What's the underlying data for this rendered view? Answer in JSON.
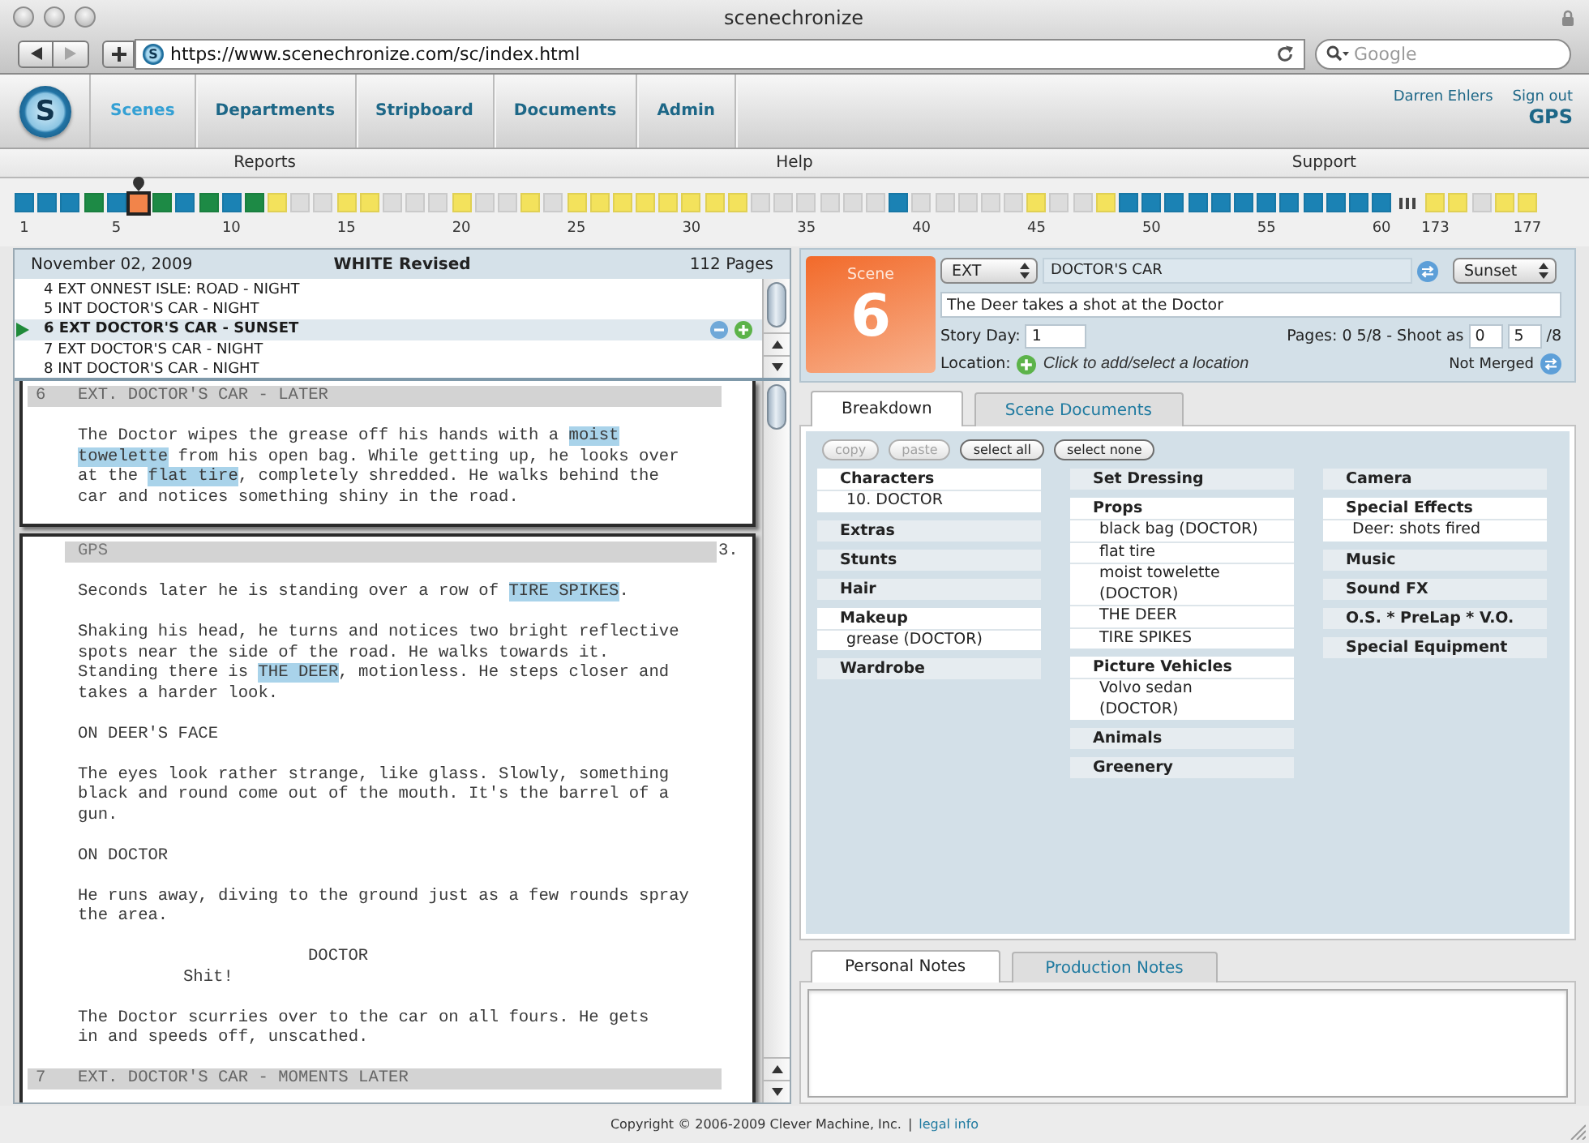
{
  "browser": {
    "title": "scenechronize",
    "nav_buttons": [
      {
        "kind": "back",
        "disabled": false
      },
      {
        "kind": "forward",
        "disabled": true
      }
    ],
    "favicon_letter": "S",
    "url": "https://www.scenechronize.com/sc/index.html",
    "search": {
      "placeholder": "Google"
    }
  },
  "app_header": {
    "logo_letter": "S",
    "nav": [
      {
        "label": "Scenes",
        "selected": true
      },
      {
        "label": "Departments",
        "selected": false
      },
      {
        "label": "Stripboard",
        "selected": false
      },
      {
        "label": "Documents",
        "selected": false
      },
      {
        "label": "Admin",
        "selected": false
      }
    ],
    "user": "Darren Ehlers",
    "sign_out": "Sign out",
    "project": "GPS"
  },
  "subnav": [
    "Reports",
    "Help",
    "Support"
  ],
  "strip": {
    "segments": [
      {
        "squares": [
          {
            "color": "#1b82b4",
            "selected": false,
            "label": "1"
          },
          {
            "color": "#1b82b4",
            "selected": false
          },
          {
            "color": "#1b82b4",
            "selected": false
          },
          {
            "color": "#1d8a45",
            "selected": false
          },
          {
            "color": "#1b82b4",
            "selected": false,
            "label": "5"
          },
          {
            "color": "#f2844a",
            "selected": true
          },
          {
            "color": "#1d8a45",
            "selected": false
          },
          {
            "color": "#1b82b4",
            "selected": false
          },
          {
            "color": "#1d8a45",
            "selected": false
          },
          {
            "color": "#1b82b4",
            "selected": false,
            "label": "10"
          },
          {
            "color": "#1d8a45",
            "selected": false
          },
          {
            "color": "#f3e25c",
            "selected": false
          },
          {
            "color": "#dcdcdc",
            "selected": false
          },
          {
            "color": "#dcdcdc",
            "selected": false
          },
          {
            "color": "#f3e25c",
            "selected": false,
            "label": "15"
          },
          {
            "color": "#f3e25c",
            "selected": false
          },
          {
            "color": "#dcdcdc",
            "selected": false
          },
          {
            "color": "#dcdcdc",
            "selected": false
          },
          {
            "color": "#dcdcdc",
            "selected": false
          },
          {
            "color": "#f3e25c",
            "selected": false,
            "label": "20"
          },
          {
            "color": "#dcdcdc",
            "selected": false
          },
          {
            "color": "#dcdcdc",
            "selected": false
          },
          {
            "color": "#f3e25c",
            "selected": false
          },
          {
            "color": "#dcdcdc",
            "selected": false
          },
          {
            "color": "#f3e25c",
            "selected": false,
            "label": "25"
          },
          {
            "color": "#f3e25c",
            "selected": false
          },
          {
            "color": "#f3e25c",
            "selected": false
          },
          {
            "color": "#f3e25c",
            "selected": false
          },
          {
            "color": "#f3e25c",
            "selected": false
          },
          {
            "color": "#f3e25c",
            "selected": false,
            "label": "30"
          },
          {
            "color": "#f3e25c",
            "selected": false
          },
          {
            "color": "#f3e25c",
            "selected": false
          },
          {
            "color": "#dcdcdc",
            "selected": false
          },
          {
            "color": "#dcdcdc",
            "selected": false
          },
          {
            "color": "#dcdcdc",
            "selected": false,
            "label": "35"
          },
          {
            "color": "#dcdcdc",
            "selected": false
          },
          {
            "color": "#dcdcdc",
            "selected": false
          },
          {
            "color": "#dcdcdc",
            "selected": false
          },
          {
            "color": "#1b82b4",
            "selected": false
          },
          {
            "color": "#dcdcdc",
            "selected": false,
            "label": "40"
          },
          {
            "color": "#dcdcdc",
            "selected": false
          },
          {
            "color": "#dcdcdc",
            "selected": false
          },
          {
            "color": "#dcdcdc",
            "selected": false
          },
          {
            "color": "#dcdcdc",
            "selected": false
          },
          {
            "color": "#f3e25c",
            "selected": false,
            "label": "45"
          },
          {
            "color": "#dcdcdc",
            "selected": false
          },
          {
            "color": "#dcdcdc",
            "selected": false
          },
          {
            "color": "#f3e25c",
            "selected": false
          },
          {
            "color": "#1b82b4",
            "selected": false
          },
          {
            "color": "#1b82b4",
            "selected": false,
            "label": "50"
          },
          {
            "color": "#1b82b4",
            "selected": false
          },
          {
            "color": "#1b82b4",
            "selected": false
          },
          {
            "color": "#1b82b4",
            "selected": false
          },
          {
            "color": "#1b82b4",
            "selected": false
          },
          {
            "color": "#1b82b4",
            "selected": false,
            "label": "55"
          },
          {
            "color": "#1b82b4",
            "selected": false
          },
          {
            "color": "#1b82b4",
            "selected": false
          },
          {
            "color": "#1b82b4",
            "selected": false
          },
          {
            "color": "#1b82b4",
            "selected": false
          },
          {
            "color": "#1b82b4",
            "selected": false,
            "label": "60"
          }
        ]
      },
      {
        "squares": [
          {
            "color": "#f3e25c",
            "selected": false,
            "label": "173"
          },
          {
            "color": "#f3e25c",
            "selected": false
          },
          {
            "color": "#dcdcdc",
            "selected": false
          },
          {
            "color": "#f3e25c",
            "selected": false
          },
          {
            "color": "#f3e25c",
            "selected": false,
            "label": "177"
          }
        ]
      }
    ]
  },
  "script_panel": {
    "date": "November 02, 2009",
    "revision": "WHITE Revised",
    "page_count": "112 Pages",
    "scenes": [
      {
        "label": "4 EXT ONNEST ISLE: ROAD - NIGHT",
        "selected": false
      },
      {
        "label": "5 INT DOCTOR'S CAR - NIGHT",
        "selected": false
      },
      {
        "label": "6 EXT DOCTOR'S CAR - SUNSET",
        "selected": true
      },
      {
        "label": "7 EXT DOCTOR'S CAR - NIGHT",
        "selected": false
      },
      {
        "label": "8 INT DOCTOR'S CAR - NIGHT",
        "selected": false
      }
    ],
    "pages": [
      {
        "blocks": [
          {
            "kind": "heading",
            "number": "6",
            "text": "EXT. DOCTOR'S CAR - LATER"
          },
          {
            "kind": "action",
            "segments": [
              {
                "text": "The Doctor wipes the grease off his hands with a ",
                "highlighted": false
              },
              {
                "text": "moist\ntowelette",
                "highlighted": true
              },
              {
                "text": " from his open bag. While getting up, he looks over\nat the ",
                "highlighted": false
              },
              {
                "text": "flat tire",
                "highlighted": true
              },
              {
                "text": ", completely shredded. He walks behind the\ncar and notices something shiny in the road.",
                "highlighted": false
              }
            ]
          }
        ]
      },
      {
        "header": "GPS",
        "page_number": "3.",
        "blocks": [
          {
            "kind": "action",
            "segments": [
              {
                "text": "Seconds later he is standing over a row of ",
                "highlighted": false
              },
              {
                "text": "TIRE SPIKES",
                "highlighted": true
              },
              {
                "text": ".",
                "highlighted": false
              }
            ]
          },
          {
            "kind": "action",
            "segments": [
              {
                "text": "Shaking his head, he turns and notices two bright reflective\nspots near the side of the road. He walks towards it.\nStanding there is ",
                "highlighted": false
              },
              {
                "text": "THE DEER",
                "highlighted": true
              },
              {
                "text": ", motionless. He steps closer and\ntakes a harder look.",
                "highlighted": false
              }
            ]
          },
          {
            "kind": "action",
            "segments": [
              {
                "text": "ON DEER'S FACE",
                "highlighted": false
              }
            ]
          },
          {
            "kind": "action",
            "segments": [
              {
                "text": "The eyes look rather strange, like glass. Slowly, something\nblack and round come out of the mouth. It's the barrel of a\ngun.",
                "highlighted": false
              }
            ]
          },
          {
            "kind": "action",
            "segments": [
              {
                "text": "ON DOCTOR",
                "highlighted": false
              }
            ]
          },
          {
            "kind": "action",
            "segments": [
              {
                "text": "He runs away, diving to the ground just as a few rounds spray\nthe area.",
                "highlighted": false
              }
            ]
          },
          {
            "kind": "character",
            "text": "DOCTOR"
          },
          {
            "kind": "dialogue",
            "text": "Shit!"
          },
          {
            "kind": "action",
            "segments": [
              {
                "text": "The Doctor scurries over to the car on all fours. He gets\nin and speeds off, unscathed.",
                "highlighted": false
              }
            ]
          },
          {
            "kind": "heading",
            "number": "7",
            "text": "EXT. DOCTOR'S CAR - MOMENTS LATER"
          }
        ]
      }
    ]
  },
  "scene": {
    "label": "Scene",
    "number": "6",
    "int_ext": "EXT",
    "set": "DOCTOR'S CAR",
    "time_of_day": "Sunset",
    "synopsis": "The Deer takes a shot at the Doctor",
    "story_day_label": "Story Day:",
    "story_day": "1",
    "pages_label": "Pages: 0 5/8 - Shoot as",
    "shoot_as_whole": "0",
    "shoot_as_eighths": "5",
    "shoot_as_denominator": "/8",
    "location_label": "Location:",
    "location_prompt": "Click to add/select a location",
    "merge_status": "Not Merged"
  },
  "breakdown": {
    "tabs": [
      {
        "label": "Breakdown",
        "selected": true
      },
      {
        "label": "Scene Documents",
        "selected": false
      }
    ],
    "buttons": [
      {
        "label": "copy",
        "disabled": true
      },
      {
        "label": "paste",
        "disabled": true
      },
      {
        "label": "select all",
        "disabled": false
      },
      {
        "label": "select none",
        "disabled": false
      }
    ],
    "columns": [
      {
        "categories": [
          {
            "name": "Characters",
            "items": [
              "10. DOCTOR"
            ]
          },
          {
            "name": "Extras"
          },
          {
            "name": "Stunts"
          },
          {
            "name": "Hair"
          },
          {
            "name": "Makeup",
            "items": [
              "grease (DOCTOR)"
            ]
          },
          {
            "name": "Wardrobe"
          }
        ]
      },
      {
        "categories": [
          {
            "name": "Set Dressing"
          },
          {
            "name": "Props",
            "items": [
              "black bag (DOCTOR)",
              "flat tire",
              "moist towelette (DOCTOR)",
              "THE DEER",
              "TIRE SPIKES"
            ]
          },
          {
            "name": "Picture Vehicles",
            "items": [
              "Volvo sedan (DOCTOR)"
            ]
          },
          {
            "name": "Animals"
          },
          {
            "name": "Greenery"
          }
        ]
      },
      {
        "categories": [
          {
            "name": "Camera"
          },
          {
            "name": "Special Effects",
            "items": [
              "Deer: shots fired"
            ]
          },
          {
            "name": "Music"
          },
          {
            "name": "Sound FX"
          },
          {
            "name": "O.S. * PreLap * V.O."
          },
          {
            "name": "Special Equipment"
          }
        ]
      }
    ]
  },
  "notes": {
    "tabs": [
      {
        "label": "Personal Notes",
        "selected": true
      },
      {
        "label": "Production Notes",
        "selected": false
      }
    ]
  },
  "footer": {
    "copyright": "Copyright © 2006-2009 Clever Machine, Inc.",
    "separator": "|",
    "link": "legal info"
  }
}
